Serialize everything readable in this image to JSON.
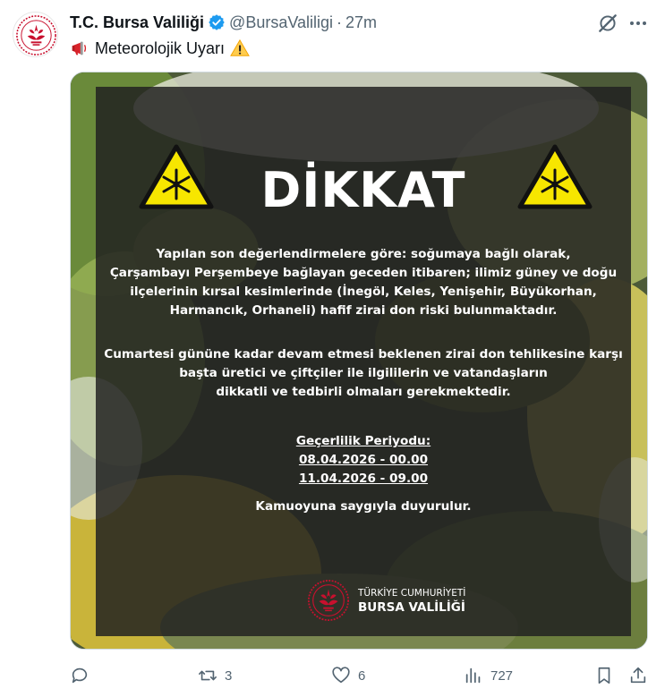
{
  "tweet": {
    "display_name": "T.C. Bursa Valiliği",
    "handle": "@BursaValiligi",
    "separator": "·",
    "time": "27m",
    "text": "Meteorolojik Uyarı",
    "text_icons": [
      "megaphone-emoji",
      "warning-emoji"
    ]
  },
  "image": {
    "title": "DİKKAT",
    "paragraph1": [
      "Yapılan son değerlendirmelere göre: soğumaya bağlı olarak,",
      "Çarşambayı Perşembeye bağlayan geceden itibaren; ilimiz güney ve doğu",
      "ilçelerinin kırsal kesimlerinde (İnegöl, Keles, Yenişehir, Büyükorhan,",
      "Harmancık, Orhaneli) hafif zirai don riski bulunmaktadır."
    ],
    "paragraph2": [
      "Cumartesi gününe kadar devam etmesi beklenen zirai don tehlikesine karşı",
      "başta üretici ve çiftçiler ile ilgililerin ve vatandaşların",
      "dikkatli ve tedbirli olmaları gerekmektedir."
    ],
    "period": {
      "label": "Geçerlilik Periyodu:",
      "start": "08.04.2026 - 00.00",
      "end": "11.04.2026 - 09.00"
    },
    "closing": "Kamuoyuna saygıyla duyurulur.",
    "logo": {
      "line1": "TÜRKİYE CUMHURİYETİ",
      "line2": "BURSA VALİLİĞİ"
    }
  },
  "actions": {
    "reply_count": "",
    "retweet_count": "3",
    "like_count": "6",
    "views_count": "727"
  },
  "colors": {
    "accent": "#1d9bf0",
    "muted": "#536471",
    "warning_yellow": "#f7e600",
    "emblem_red": "#c8102e"
  }
}
